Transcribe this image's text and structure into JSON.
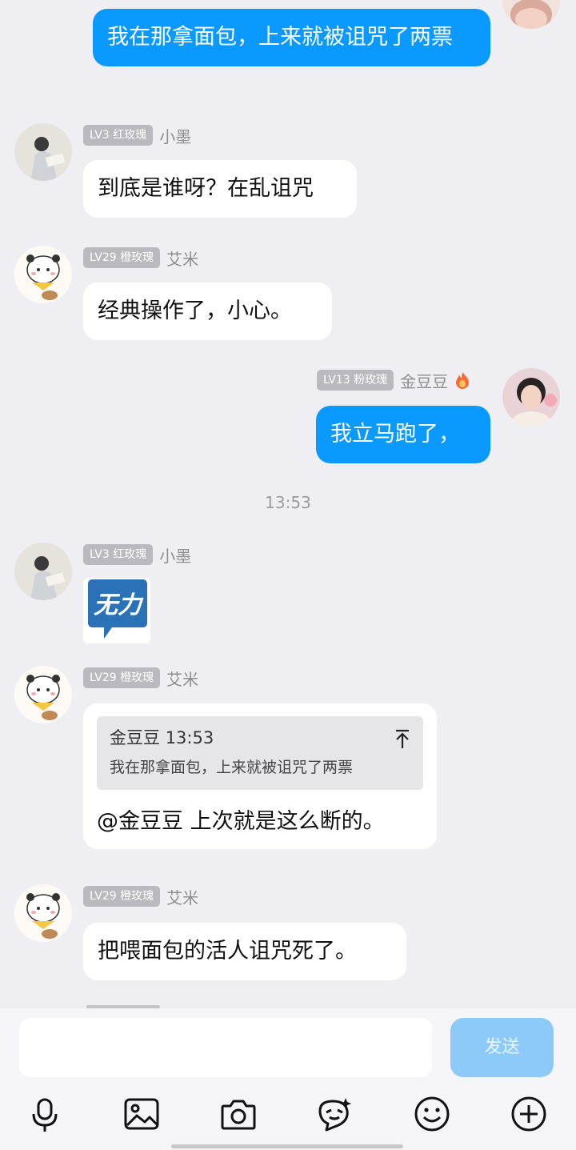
{
  "messages": {
    "m1": {
      "text": "我在那拿面包，上来就被诅咒了两票"
    },
    "m2": {
      "level": "LV3 红玫瑰",
      "name": "小墨",
      "text": "到底是谁呀？在乱诅咒"
    },
    "m3": {
      "level": "LV29 橙玫瑰",
      "name": "艾米",
      "text": "经典操作了，小心。"
    },
    "m4": {
      "level": "LV13 粉玫瑰",
      "name": "金豆豆",
      "text": "我立马跑了，"
    },
    "time_sep": "13:53",
    "m5": {
      "level": "LV3 红玫瑰",
      "name": "小墨",
      "sticker_text": "无力"
    },
    "m6": {
      "level": "LV29 橙玫瑰",
      "name": "艾米",
      "quote_author": "金豆豆",
      "quote_time": "13:53",
      "quote_text": "我在那拿面包，上来就被诅咒了两票",
      "text": "@金豆豆 上次就是这么断的。"
    },
    "m7": {
      "level": "LV29 橙玫瑰",
      "name": "艾米",
      "text": "把喂面包的活人诅咒死了。"
    }
  },
  "composer": {
    "input_value": "",
    "send_label": "发送",
    "tools": [
      "microphone-icon",
      "image-icon",
      "camera-icon",
      "sticker-icon",
      "emoji-icon",
      "plus-icon"
    ]
  },
  "colors": {
    "self_bubble": "#0a99ff",
    "other_bubble": "#ffffff",
    "send_disabled": "#8ccbf9",
    "background": "#efeff3"
  }
}
